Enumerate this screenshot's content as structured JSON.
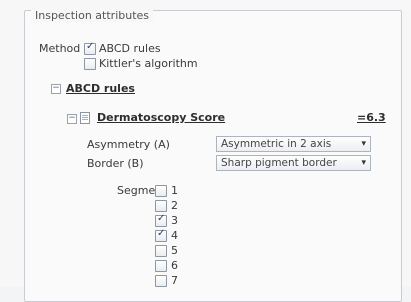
{
  "group_title": "Inspection attributes",
  "method": {
    "label": "Method",
    "options": [
      {
        "label": "ABCD rules",
        "checked": true
      },
      {
        "label": "Kittler's algorithm",
        "checked": false
      }
    ]
  },
  "abcd": {
    "toggle": "⊟",
    "label": "ABCD rules",
    "score": {
      "toggle": "⊟",
      "label": "Dermatoscopy Score",
      "value": "=6.3"
    },
    "asymmetry": {
      "label": "Asymmetry (A)",
      "value": "Asymmetric in 2 axis"
    },
    "border": {
      "label": "Border (B)",
      "value": "Sharp pigment border"
    },
    "segment": {
      "label": "Segment",
      "items": [
        {
          "label": "1",
          "checked": false
        },
        {
          "label": "2",
          "checked": false
        },
        {
          "label": "3",
          "checked": true
        },
        {
          "label": "4",
          "checked": true
        },
        {
          "label": "5",
          "checked": false
        },
        {
          "label": "6",
          "checked": false
        },
        {
          "label": "7",
          "checked": false
        }
      ]
    }
  },
  "dropdown_arrow": "▾"
}
